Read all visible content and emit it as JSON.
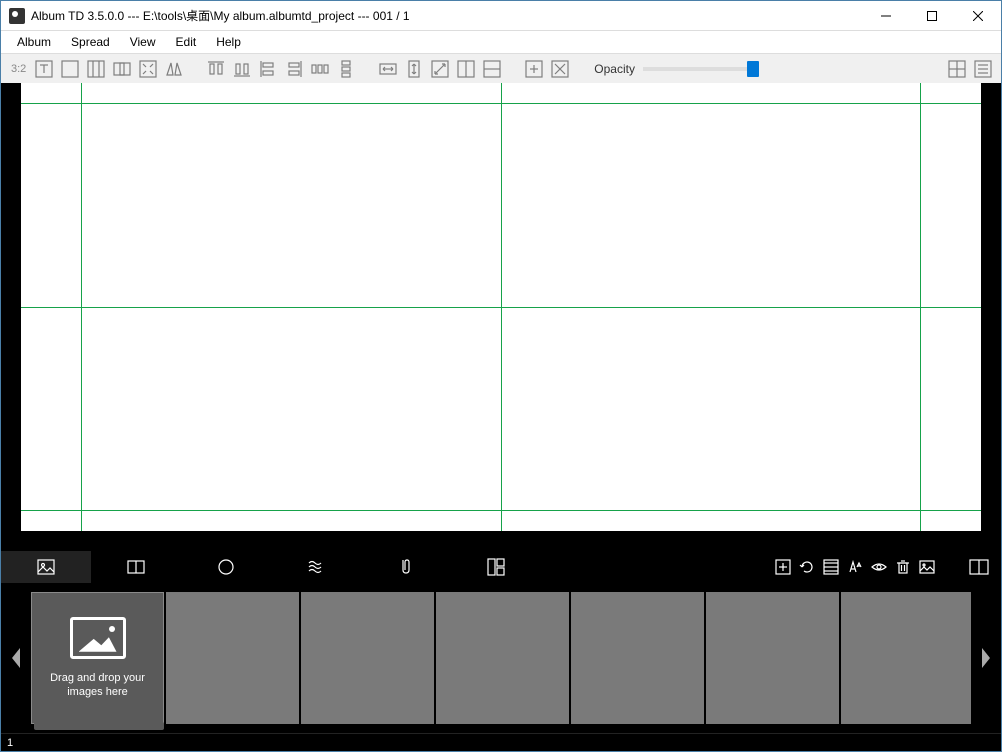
{
  "window": {
    "title": "Album TD 3.5.0.0 --- E:\\tools\\桌面\\My album.albumtd_project --- 001 / 1"
  },
  "menu": {
    "items": [
      "Album",
      "Spread",
      "View",
      "Edit",
      "Help"
    ]
  },
  "toolbar": {
    "ratio": "3:2",
    "opacity_label": "Opacity",
    "opacity_value": 100
  },
  "drop_zone": {
    "text": "Drag and drop your images here"
  },
  "status": {
    "page": "1"
  }
}
